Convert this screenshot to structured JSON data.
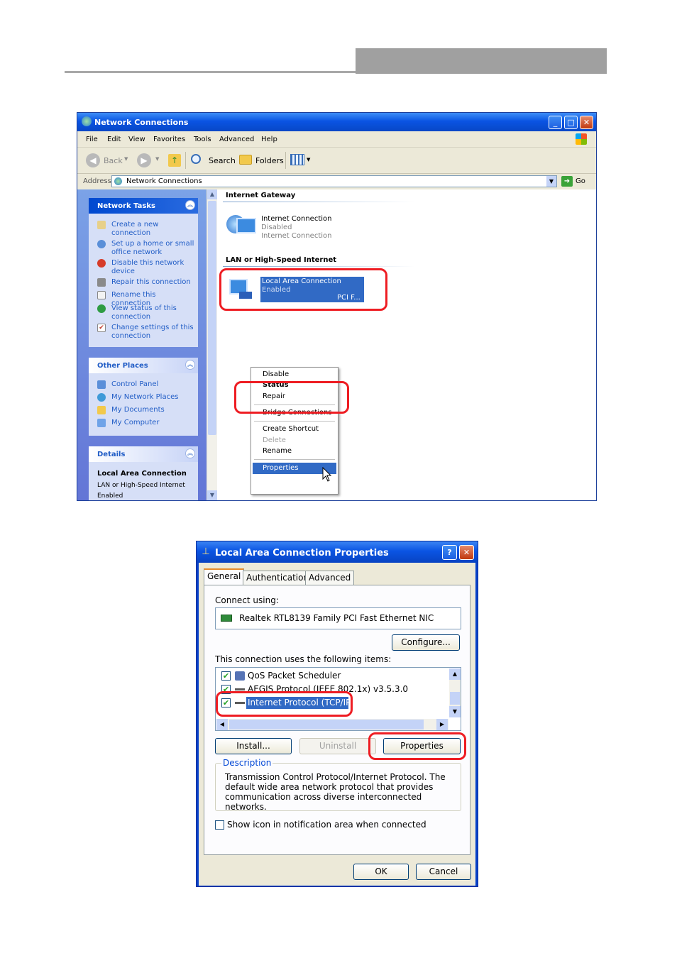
{
  "explorer": {
    "title": "Network Connections",
    "menu": [
      "File",
      "Edit",
      "View",
      "Favorites",
      "Tools",
      "Advanced",
      "Help"
    ],
    "toolbar": {
      "back": "Back",
      "search": "Search",
      "folders": "Folders"
    },
    "address": {
      "label": "Address",
      "value": "Network Connections",
      "go": "Go"
    },
    "network_tasks": {
      "title": "Network Tasks",
      "items": [
        "Create a new connection",
        "Set up a home or small office network",
        "Disable this network device",
        "Repair this connection",
        "Rename this connection",
        "View status of this connection",
        "Change settings of this connection"
      ]
    },
    "other_places": {
      "title": "Other Places",
      "items": [
        "Control Panel",
        "My Network Places",
        "My Documents",
        "My Computer"
      ]
    },
    "details": {
      "title": "Details",
      "name": "Local Area Connection",
      "type": "LAN or High-Speed Internet",
      "status": "Enabled"
    },
    "groups": {
      "gateway": "Internet Gateway",
      "lan": "LAN or High-Speed Internet"
    },
    "gateway_item": {
      "name": "Internet Connection",
      "status": "Disabled",
      "type": "Internet Connection"
    },
    "lan_item": {
      "name": "Local Area Connection",
      "status": "Enabled",
      "device": "PCI F..."
    },
    "context_menu": [
      "Disable",
      "Status",
      "Repair",
      "Bridge Connections",
      "Create Shortcut",
      "Delete",
      "Rename",
      "Properties"
    ]
  },
  "dialog": {
    "title": "Local Area Connection Properties",
    "tabs": [
      "General",
      "Authentication",
      "Advanced"
    ],
    "connect_using_label": "Connect using:",
    "adapter": "Realtek RTL8139 Family PCI Fast Ethernet NIC",
    "configure": "Configure...",
    "items_label": "This connection uses the following items:",
    "items": [
      "QoS Packet Scheduler",
      "AEGIS Protocol (IEEE 802.1x) v3.5.3.0",
      "Internet Protocol (TCP/IP)"
    ],
    "install": "Install...",
    "uninstall": "Uninstall",
    "properties": "Properties",
    "description_label": "Description",
    "description": "Transmission Control Protocol/Internet Protocol. The default wide area network protocol that provides communication across diverse interconnected networks.",
    "show_icon": "Show icon in notification area when connected",
    "ok": "OK",
    "cancel": "Cancel",
    "help_glyph": "?",
    "close_glyph": "✕"
  }
}
